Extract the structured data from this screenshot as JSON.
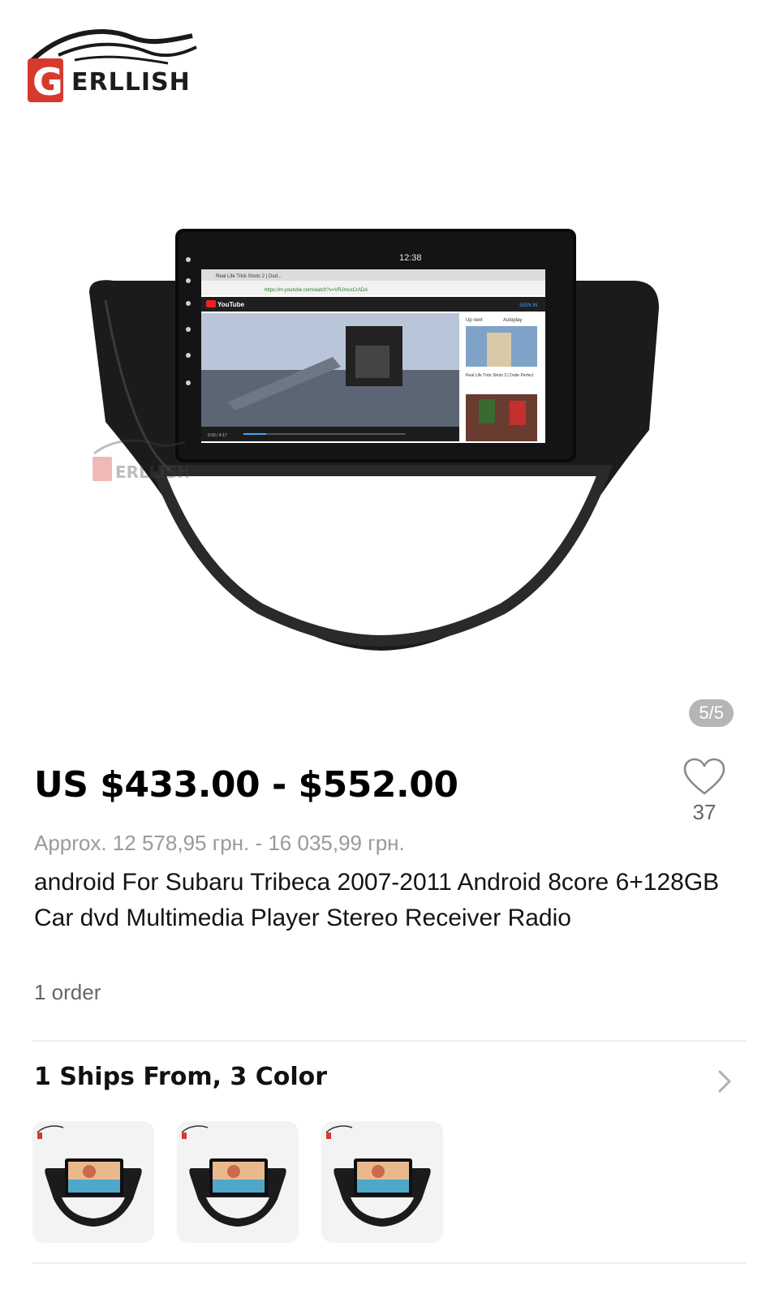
{
  "gallery": {
    "brand_logo_text": "ERLLISH",
    "brand_logo_letter": "G",
    "watermark_text": "ERLLISH",
    "counter": "5/5",
    "screen": {
      "tab_title": "Real Life Trick Shots 2 | Dud...",
      "url": "https://m.youtube.com/watch?v=VRJmcxCrADA",
      "site": "YouTube",
      "sign_in": "SIGN IN",
      "up_next": "Up next",
      "autoplay": "Autoplay",
      "clock": "12:38",
      "time_progress": "0:33 / 4:17",
      "video_title": "Real Life Trick Shots 3 | Dude Perfect"
    }
  },
  "product": {
    "price": "US $433.00 - $552.00",
    "approx_price": "Approx. 12 578,95 грн. - 16 035,99 грн.",
    "title": "android For Subaru Tribeca 2007-2011 Android 8core 6+128GB Car dvd Multimedia Player Stereo Receiver Radio",
    "orders": "1 order",
    "wishlist_count": "37"
  },
  "variants": {
    "label": "1 Ships From, 3 Color",
    "thumbnails": [
      "variant-1",
      "variant-2",
      "variant-3"
    ]
  },
  "colors": {
    "brand_red": "#d63a2f",
    "text_dark": "#111111",
    "text_muted": "#9a9a9a",
    "counter_bg": "#b5b5b5",
    "thumb_bg": "#f3f3f3"
  },
  "icons": {
    "wishlist": "heart-outline-icon",
    "more": "chevron-right-icon"
  }
}
